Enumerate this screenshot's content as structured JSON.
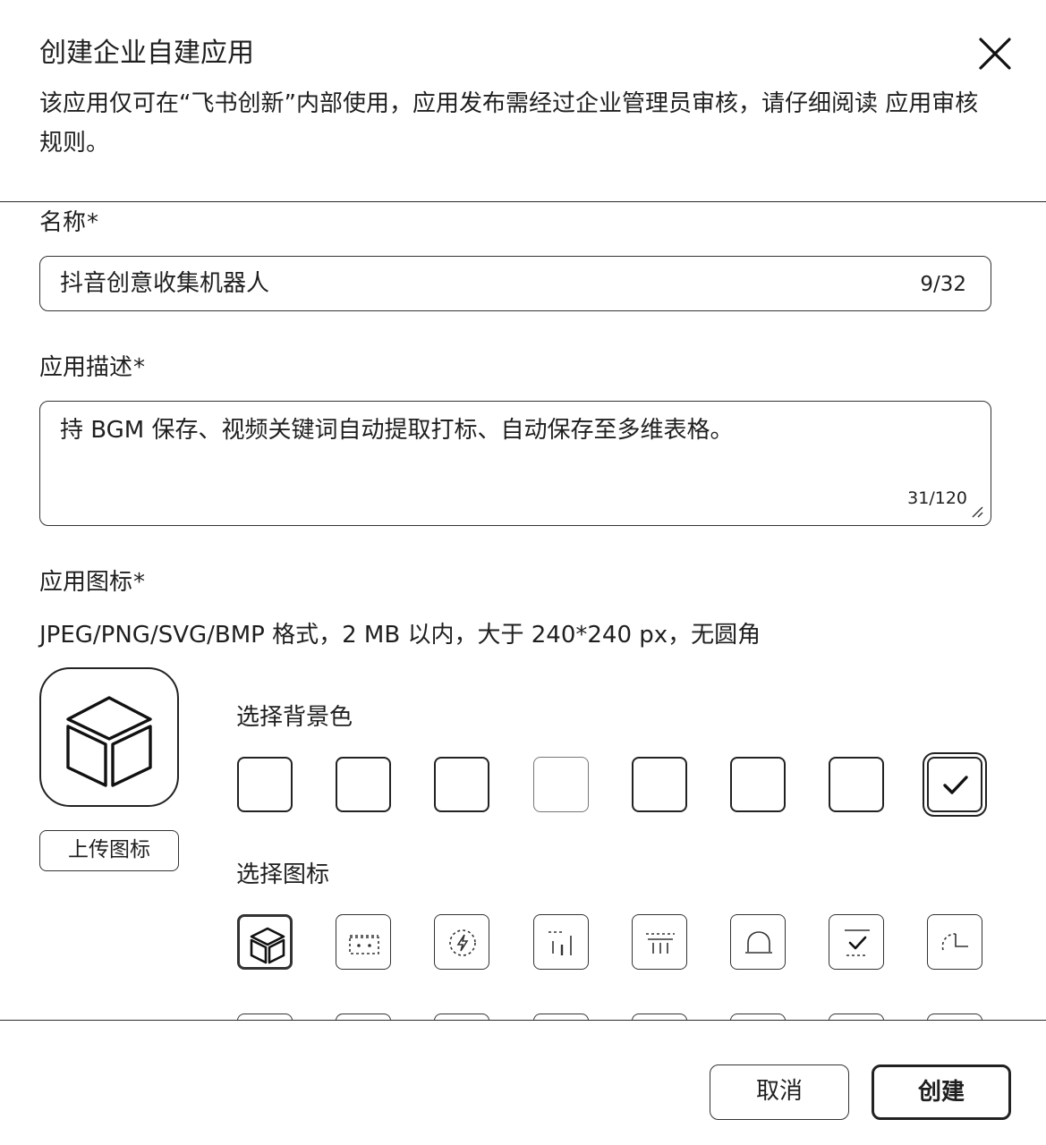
{
  "dialog": {
    "title": "创建企业自建应用",
    "notice": "该应用仅可在“飞书创新”内部使用，应用发布需经过企业管理员审核，请仔细阅读 应用审核规则。"
  },
  "form": {
    "name": {
      "label": "名称",
      "required_mark": "*",
      "value": "抖音创意收集机器人",
      "counter": "9/32"
    },
    "description": {
      "label": "应用描述",
      "required_mark": "*",
      "value": "持 BGM 保存、视频关键词自动提取打标、自动保存至多维表格。",
      "counter": "31/120"
    },
    "icon": {
      "label": "应用图标",
      "required_mark": "*",
      "hint": "JPEG/PNG/SVG/BMP 格式，2 MB 以内，大于 240*240 px，无圆角",
      "upload_label": "上传图标",
      "background_label": "选择背景色",
      "background_swatches": [
        {
          "id": "bg-1",
          "selected": false
        },
        {
          "id": "bg-2",
          "selected": false
        },
        {
          "id": "bg-3",
          "selected": false
        },
        {
          "id": "bg-4",
          "selected": false
        },
        {
          "id": "bg-5",
          "selected": false
        },
        {
          "id": "bg-6",
          "selected": false
        },
        {
          "id": "bg-7",
          "selected": false
        },
        {
          "id": "bg-8",
          "selected": true
        }
      ],
      "icon_label": "选择图标",
      "icon_options": [
        {
          "icon": "cube-icon",
          "selected": true
        },
        {
          "icon": "robot-icon",
          "selected": false
        },
        {
          "icon": "lightning-icon",
          "selected": false
        },
        {
          "icon": "chart-icon",
          "selected": false
        },
        {
          "icon": "calendar-icon",
          "selected": false
        },
        {
          "icon": "bell-icon",
          "selected": false
        },
        {
          "icon": "checklist-icon",
          "selected": false
        },
        {
          "icon": "clock-icon",
          "selected": false
        }
      ]
    }
  },
  "footer": {
    "cancel_label": "取消",
    "create_label": "创建"
  }
}
